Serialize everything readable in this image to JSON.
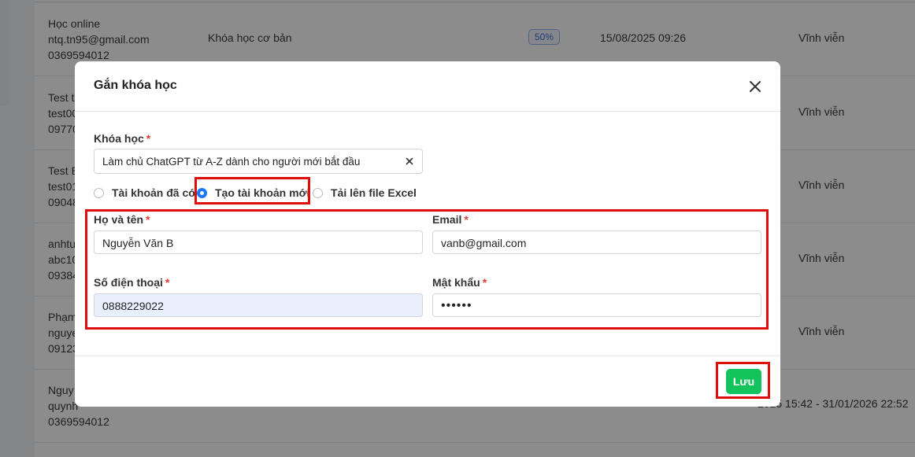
{
  "background": {
    "rows": [
      {
        "user": "Học online\nntq.tn95@gmail.com\n0369594012",
        "course": "Khóa học cơ bản",
        "badge": "50%",
        "date": "15/08/2025 09:26",
        "term": "Vĩnh viễn"
      },
      {
        "user": "Test t\ntest00\n09770",
        "term": "Vĩnh viễn"
      },
      {
        "user": "Test E\ntest01\n09048",
        "term": "Vĩnh viễn"
      },
      {
        "user": "anhtu\nabc10\n09384",
        "term": "Vĩnh viễn"
      },
      {
        "user": "Phạm\nnguye\n09123",
        "term": "Vĩnh viễn"
      },
      {
        "user": "Nguy\nquynh\n0369594012",
        "term": "2025 15:42 - 31/01/2026 22:52"
      }
    ]
  },
  "modal": {
    "title": "Gắn khóa học",
    "course_label": "Khóa học",
    "course_value": "Làm chủ ChatGPT từ A-Z dành cho người mới bắt đầu",
    "radios": [
      {
        "label": "Tài khoản đã có",
        "checked": false
      },
      {
        "label": "Tạo tài khoản mới",
        "checked": true
      },
      {
        "label": "Tải lên file Excel",
        "checked": false
      }
    ],
    "fields": {
      "name_label": "Họ và tên",
      "name_value": "Nguyễn Văn B",
      "email_label": "Email",
      "email_value": "vanb@gmail.com",
      "phone_label": "Số điện thoại",
      "phone_value": "0888229022",
      "password_label": "Mật khẩu",
      "password_value": "••••••"
    },
    "save_label": "Lưu"
  },
  "colors": {
    "accent": "#1976ff",
    "save": "#12c45b",
    "highlight": "#e00d0d",
    "required": "#e53935"
  },
  "icons": [
    "close-icon",
    "clear-icon"
  ]
}
